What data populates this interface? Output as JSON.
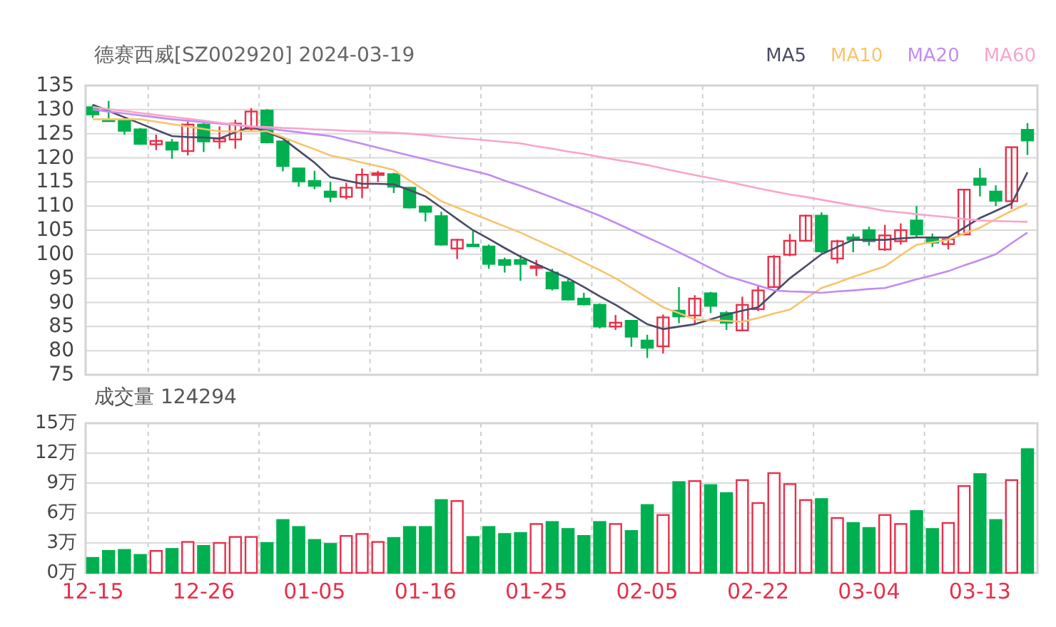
{
  "header": {
    "title": "德赛西威[SZ002920] 2024-03-19"
  },
  "price_chart": {
    "chart_data": {
      "type": "candlestick",
      "grid": true,
      "ylim": [
        75,
        135
      ],
      "yticks": [
        75,
        80,
        85,
        90,
        95,
        100,
        105,
        110,
        115,
        120,
        125,
        130,
        135
      ],
      "series": [
        {
          "name": "MA5",
          "type": "line",
          "color": "#4b4a68",
          "values": [
            131,
            129.7,
            128.4,
            127.1,
            125.8,
            124.5,
            124.3,
            124.2,
            124,
            125.3,
            126.5,
            125.3,
            124,
            121.5,
            119,
            116,
            115.3,
            114.6,
            114.6,
            114.5,
            113.3,
            112,
            109.7,
            107.3,
            105,
            103.2,
            101.3,
            99.5,
            98,
            96.5,
            95,
            93.2,
            91.3,
            89.5,
            87.5,
            85.5,
            84.5,
            85,
            85.5,
            86.5,
            87.5,
            88.3,
            89,
            92,
            95,
            97.5,
            100,
            101.5,
            103,
            103,
            103,
            103.3,
            103.5,
            103.5,
            103.5,
            105.5,
            107.5,
            109,
            110.5,
            117
          ]
        },
        {
          "name": "MA10",
          "type": "line",
          "color": "#f7c46c",
          "values": [
            128,
            128,
            128,
            128,
            127.5,
            127,
            126.5,
            126,
            125.5,
            125.5,
            125.5,
            125.5,
            124.3,
            123,
            121.8,
            120.5,
            119.8,
            119,
            118.3,
            117.5,
            115.3,
            113.2,
            111,
            109.7,
            108.4,
            107.1,
            105.8,
            104.5,
            103,
            101.5,
            100,
            98.3,
            96.7,
            95,
            93,
            91,
            89,
            87.8,
            86.5,
            86.3,
            86.2,
            86,
            86.8,
            87.7,
            88.5,
            90.8,
            93,
            94.1,
            95.3,
            96.4,
            97.5,
            99.8,
            102,
            102.5,
            103,
            104.3,
            105.5,
            107.3,
            109,
            110.5
          ]
        },
        {
          "name": "MA20",
          "type": "line",
          "color": "#c28cf0",
          "values": [
            130,
            129.6,
            129.2,
            128.8,
            128.4,
            128,
            127.7,
            127.4,
            127.1,
            126.8,
            126.5,
            126.1,
            125.7,
            125.3,
            124.9,
            124.5,
            123.7,
            122.9,
            122.1,
            121.3,
            120.5,
            119.7,
            118.9,
            118.1,
            117.3,
            116.5,
            115.3,
            114.2,
            113,
            111.8,
            110.5,
            109.3,
            108,
            106.5,
            105,
            103.5,
            102,
            100.4,
            98.8,
            97.1,
            95.5,
            94.5,
            93.5,
            92.5,
            92.3,
            92.2,
            92,
            92.3,
            92.5,
            92.8,
            93,
            93.9,
            94.8,
            95.6,
            96.5,
            97.7,
            98.8,
            100,
            102.3,
            104.5
          ]
        },
        {
          "name": "MA60",
          "type": "line",
          "color": "#f8a5cb",
          "values": [
            130.5,
            130.1,
            129.7,
            129.3,
            128.9,
            128.5,
            128.1,
            127.7,
            127.3,
            126.9,
            126.5,
            126.4,
            126.2,
            126.1,
            125.9,
            125.8,
            125.6,
            125.5,
            125.3,
            125.2,
            125,
            124.7,
            124.4,
            124.1,
            123.9,
            123.6,
            123.3,
            123,
            122.4,
            121.9,
            121.3,
            120.8,
            120.2,
            119.6,
            119.1,
            118.5,
            117.8,
            117.1,
            116.4,
            115.8,
            115.1,
            114.4,
            113.7,
            113,
            112.4,
            111.9,
            111.3,
            110.7,
            110.1,
            109.6,
            109,
            108.7,
            108.3,
            108,
            107.7,
            107.3,
            107,
            106.9,
            106.8,
            106.7
          ]
        }
      ],
      "ohlc": [
        [
          130.5,
          131,
          128.3,
          129
        ],
        [
          128,
          131.8,
          127.5,
          127.6
        ],
        [
          127.9,
          128.2,
          124.8,
          125.6
        ],
        [
          125.9,
          126.2,
          122.7,
          122.9
        ],
        [
          122.8,
          124.8,
          121.6,
          123.5
        ],
        [
          123.2,
          123.9,
          119.8,
          121.7
        ],
        [
          121.4,
          127.5,
          120.5,
          126.9
        ],
        [
          126.9,
          127.3,
          121.2,
          123.4
        ],
        [
          123.4,
          126.5,
          121.9,
          124
        ],
        [
          123.8,
          127.9,
          121.9,
          127.1
        ],
        [
          126,
          130.3,
          125.5,
          129.6
        ],
        [
          129.8,
          130.1,
          123,
          123.2
        ],
        [
          123.4,
          123.6,
          117.2,
          118.3
        ],
        [
          117.8,
          117.8,
          114,
          115.1
        ],
        [
          115.2,
          117.3,
          113.5,
          114.2
        ],
        [
          113,
          115,
          110.8,
          111.9
        ],
        [
          111.9,
          114.8,
          111.4,
          113.8
        ],
        [
          113.8,
          117.8,
          111.6,
          116.5
        ],
        [
          116.5,
          117.3,
          115,
          116.8
        ],
        [
          116.6,
          116.9,
          112.7,
          114
        ],
        [
          113.8,
          113.9,
          109.5,
          109.7
        ],
        [
          109.9,
          110,
          106.8,
          108.8
        ],
        [
          107.9,
          108.8,
          101.8,
          102
        ],
        [
          101.2,
          103.2,
          99,
          103
        ],
        [
          102,
          105,
          101.6,
          101.8
        ],
        [
          101.6,
          102,
          97,
          98
        ],
        [
          98.8,
          99.3,
          96.2,
          97.8
        ],
        [
          98.8,
          99.8,
          94.5,
          98
        ],
        [
          97.3,
          98.8,
          95.5,
          97.5
        ],
        [
          96.2,
          97,
          92.5,
          92.9
        ],
        [
          94.2,
          94.8,
          90.4,
          90.6
        ],
        [
          90.8,
          92,
          89.4,
          89.6
        ],
        [
          89.5,
          89.8,
          84.6,
          85
        ],
        [
          85,
          87.4,
          84.3,
          85.8
        ],
        [
          86.2,
          86.2,
          80.8,
          82.9
        ],
        [
          82.1,
          83.3,
          78.5,
          80.6
        ],
        [
          80.9,
          87.5,
          79.4,
          86.9
        ],
        [
          88.3,
          93.2,
          85.7,
          87.1
        ],
        [
          87.3,
          91.5,
          85.5,
          90.8
        ],
        [
          91.9,
          92.2,
          87.8,
          89.3
        ],
        [
          87.8,
          88.2,
          84.3,
          85.8
        ],
        [
          84.2,
          91.2,
          84.2,
          89.5
        ],
        [
          88.6,
          93.5,
          88.2,
          92.5
        ],
        [
          93.2,
          99.8,
          93,
          99.5
        ],
        [
          99.9,
          104.2,
          99.6,
          102.8
        ],
        [
          102.8,
          108.2,
          102.6,
          108
        ],
        [
          108,
          108.7,
          100.2,
          100.6
        ],
        [
          99.1,
          103,
          98.1,
          102.7
        ],
        [
          103.5,
          104.2,
          100.4,
          103
        ],
        [
          105,
          105.7,
          101.8,
          102.7
        ],
        [
          101,
          106.1,
          100.7,
          103.9
        ],
        [
          102.7,
          106.4,
          102,
          105
        ],
        [
          107,
          110,
          103.5,
          104.1
        ],
        [
          103.2,
          104.3,
          101.5,
          102.4
        ],
        [
          102.1,
          103.3,
          101,
          103.1
        ],
        [
          104.1,
          113.4,
          104.1,
          113.4
        ],
        [
          115.7,
          117.9,
          112,
          114.4
        ],
        [
          113,
          114.3,
          110,
          111.1
        ],
        [
          111,
          122.2,
          109.4,
          122.2
        ],
        [
          125.8,
          127.2,
          120.6,
          123.6
        ]
      ]
    }
  },
  "volume_chart": {
    "title": "成交量 124294",
    "chart_data": {
      "type": "bar",
      "grid": true,
      "ylim": [
        0,
        15
      ],
      "yticks": [
        {
          "value": 0,
          "label": "0万"
        },
        {
          "value": 3,
          "label": "3万"
        },
        {
          "value": 6,
          "label": "6万"
        },
        {
          "value": 9,
          "label": "9万"
        },
        {
          "value": 12,
          "label": "12万"
        },
        {
          "value": 15,
          "label": "15万"
        }
      ],
      "categories": [
        "12-15",
        null,
        null,
        null,
        null,
        null,
        null,
        "12-26",
        null,
        null,
        null,
        null,
        null,
        null,
        "01-05",
        null,
        null,
        null,
        null,
        null,
        null,
        "01-16",
        null,
        null,
        null,
        null,
        null,
        null,
        "01-25",
        null,
        null,
        null,
        null,
        null,
        null,
        "02-05",
        null,
        null,
        null,
        null,
        null,
        null,
        "02-22",
        null,
        null,
        null,
        null,
        null,
        null,
        "03-04",
        null,
        null,
        null,
        null,
        null,
        null,
        "03-13",
        null,
        null,
        null
      ],
      "values": [
        1.5,
        2.2,
        2.3,
        1.8,
        2.2,
        2.4,
        3.1,
        2.7,
        3.0,
        3.6,
        3.6,
        3.0,
        5.3,
        4.6,
        3.3,
        2.9,
        3.7,
        3.9,
        3.1,
        3.5,
        4.6,
        4.6,
        7.3,
        7.2,
        3.6,
        4.6,
        3.9,
        4.0,
        4.9,
        5.1,
        4.4,
        3.7,
        5.1,
        4.9,
        4.2,
        6.8,
        5.8,
        9.1,
        9.2,
        8.8,
        8.0,
        9.3,
        7.0,
        10.0,
        8.9,
        7.3,
        7.4,
        5.5,
        5.0,
        4.5,
        5.8,
        4.9,
        6.2,
        4.4,
        5.0,
        8.7,
        9.9,
        5.3,
        9.3,
        12.4
      ]
    }
  }
}
